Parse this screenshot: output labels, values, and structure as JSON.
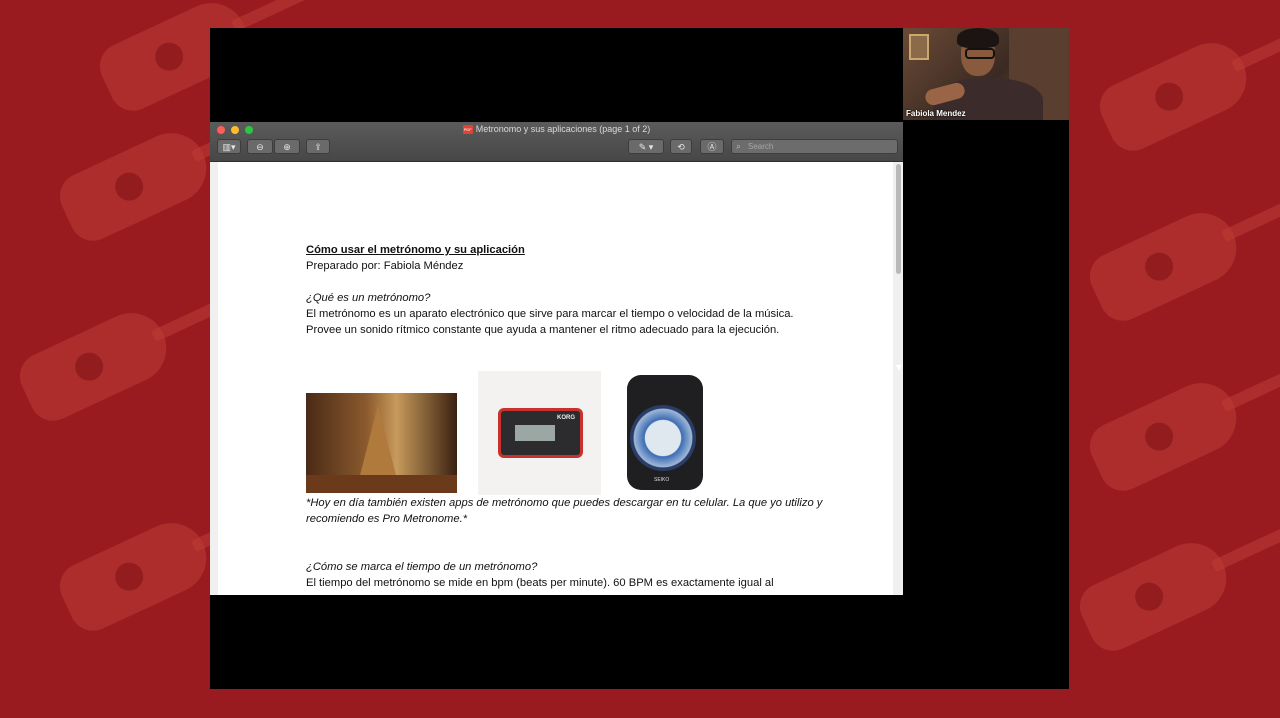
{
  "meeting": {
    "participant_name": "Fabiola Mendez"
  },
  "window": {
    "title": "Metronomo y sus aplicaciones (page 1 of 2)",
    "pdf_badge": "PDF",
    "search_placeholder": "Search"
  },
  "toolbar": {
    "sidebar_icon": "sidebar-icon",
    "zoom_out_icon": "zoom-out-icon",
    "zoom_in_icon": "zoom-in-icon",
    "share_icon": "share-icon",
    "markup_icon": "pen-icon",
    "rotate_icon": "rotate-icon",
    "annotate_icon": "annotate-icon"
  },
  "document": {
    "title": "Cómo usar el metrónomo y su aplicación",
    "author_line": "Preparado por: Fabiola Méndez",
    "q1": "¿Qué es un metrónomo?",
    "p1": "El metrónomo es un aparato electrónico que sirve para marcar el tiempo o velocidad de la música. Provee un sonido rítmico constante que ayuda a mantener el ritmo adecuado para la ejecución.",
    "note": "*Hoy en día también existen apps de metrónomo que puedes descargar en tu celular. La que yo utilizo y recomiendo es Pro Metronome.*",
    "q2": "¿Cómo se marca el tiempo de un metrónomo?",
    "p2": "El tiempo del metrónomo se mide en bpm (beats per minute). 60 BPM es exactamente igual al",
    "images": {
      "korg_label": "KORG",
      "seiko_label": "SEIKO"
    }
  },
  "colors": {
    "background": "#9a1b1f",
    "titlebar": "#4f4f4f"
  }
}
